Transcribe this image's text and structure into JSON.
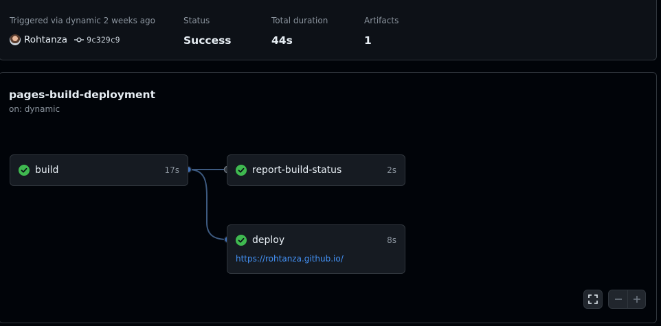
{
  "summary": {
    "trigger_label": "Triggered via dynamic 2 weeks ago",
    "user": "Rohtanza",
    "commit_sha": "9c329c9",
    "status_label": "Status",
    "status_value": "Success",
    "duration_label": "Total duration",
    "duration_value": "44s",
    "artifacts_label": "Artifacts",
    "artifacts_value": "1"
  },
  "workflow": {
    "title": "pages-build-deployment",
    "subtitle": "on: dynamic",
    "jobs": [
      {
        "name": "build",
        "duration": "17s",
        "status": "success"
      },
      {
        "name": "report-build-status",
        "duration": "2s",
        "status": "success"
      },
      {
        "name": "deploy",
        "duration": "8s",
        "status": "success",
        "url": "https://rohtanza.github.io/"
      }
    ]
  },
  "controls": {
    "fullscreen_icon": "fullscreen-icon",
    "zoom_out_icon": "minus-icon",
    "zoom_in_icon": "plus-icon"
  },
  "colors": {
    "success": "#3fb950",
    "link": "#4493f8",
    "connector": "#3d5a80",
    "background": "#010409"
  }
}
